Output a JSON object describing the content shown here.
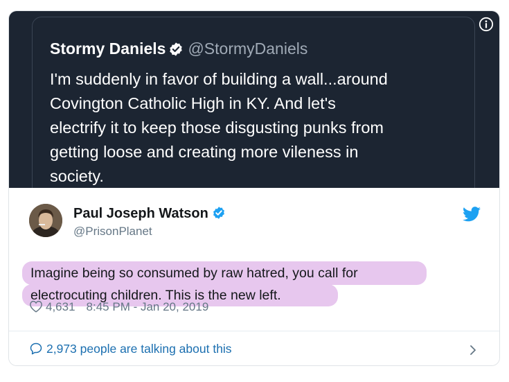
{
  "quoted_tweet": {
    "name": "Stormy Daniels",
    "handle": "@StormyDaniels",
    "lines": [
      "I'm suddenly in favor of building a wall...around",
      "Covington Catholic High in KY. And let's",
      "electrify it to keep those disgusting punks from",
      "getting loose and creating more vileness in",
      "society."
    ]
  },
  "tweet": {
    "name": "Paul Joseph Watson",
    "handle": "@PrisonPlanet",
    "lines": [
      "Imagine being so consumed by raw hatred, you call for",
      "electrocuting children. This is the new left."
    ],
    "likes": "4,631",
    "time": "8:45 PM - Jan 20, 2019",
    "talking": "2,973 people are talking about this"
  },
  "colors": {
    "dark_bg": "#1c2532",
    "highlight": "#e7c7ee",
    "twitter_blue": "#1da1f2",
    "link": "#1b6fb0"
  },
  "icons": [
    "info-icon",
    "verified-icon",
    "twitter-bird-icon",
    "heart-icon",
    "speech-bubble-icon",
    "chevron-right-icon"
  ]
}
